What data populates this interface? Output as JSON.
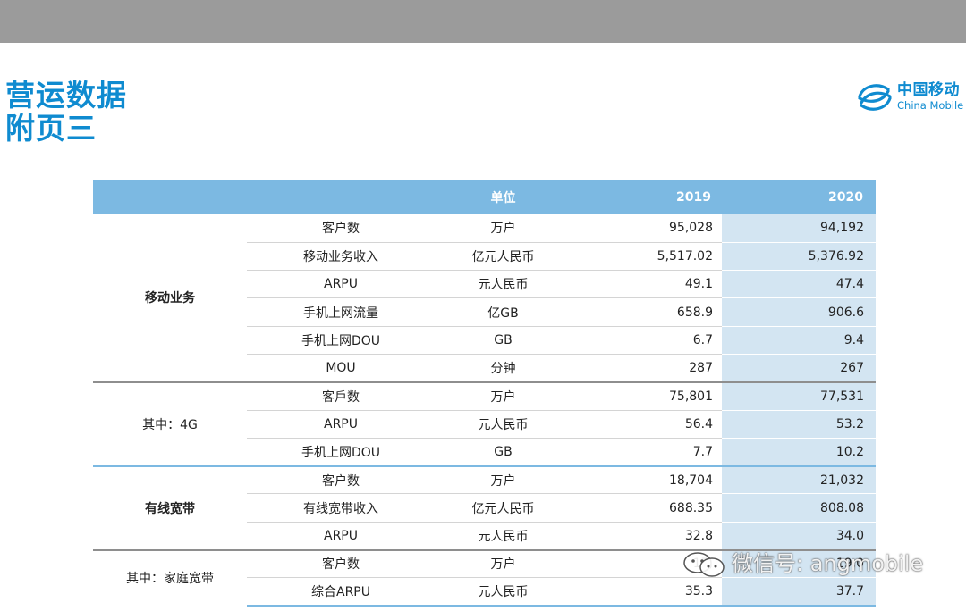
{
  "title_lines": [
    "营运数据",
    "附页三"
  ],
  "logo": {
    "cn": "中国移动",
    "en": "China Mobile",
    "color": "#0f8bd0"
  },
  "table": {
    "headers": {
      "group": "",
      "item": "",
      "unit": "单位",
      "y2019": "2019",
      "y2020": "2020"
    },
    "groups": [
      {
        "name": "移动业务",
        "bold": true,
        "rows": [
          {
            "item": "客户数",
            "unit": "万户",
            "v2019": "95,028",
            "v2020": "94,192"
          },
          {
            "item": "移动业务收入",
            "unit": "亿元人民币",
            "v2019": "5,517.02",
            "v2020": "5,376.92"
          },
          {
            "item": "ARPU",
            "unit": "元人民币",
            "v2019": "49.1",
            "v2020": "47.4"
          },
          {
            "item": "手机上网流量",
            "unit": "亿GB",
            "v2019": "658.9",
            "v2020": "906.6"
          },
          {
            "item": "手机上网DOU",
            "unit": "GB",
            "v2019": "6.7",
            "v2020": "9.4"
          },
          {
            "item": "MOU",
            "unit": "分钟",
            "v2019": "287",
            "v2020": "267"
          }
        ]
      },
      {
        "name": "其中：4G",
        "bold": false,
        "rows": [
          {
            "item": "客戶数",
            "unit": "万户",
            "v2019": "75,801",
            "v2020": "77,531"
          },
          {
            "item": "ARPU",
            "unit": "元人民币",
            "v2019": "56.4",
            "v2020": "53.2"
          },
          {
            "item": "手机上网DOU",
            "unit": "GB",
            "v2019": "7.7",
            "v2020": "10.2"
          }
        ]
      },
      {
        "name": "有线宽带",
        "bold": true,
        "rows": [
          {
            "item": "客户数",
            "unit": "万户",
            "v2019": "18,704",
            "v2020": "21,032"
          },
          {
            "item": "有线宽带收入",
            "unit": "亿元人民币",
            "v2019": "688.35",
            "v2020": "808.08"
          },
          {
            "item": "ARPU",
            "unit": "元人民币",
            "v2019": "32.8",
            "v2020": "34.0"
          }
        ]
      },
      {
        "name": "其中：家庭宽带",
        "bold": false,
        "rows": [
          {
            "item": "客户数",
            "unit": "万户",
            "v2019": "17,",
            "v2020": "19,0"
          },
          {
            "item": "综合ARPU",
            "unit": "元人民币",
            "v2019": "35.3",
            "v2020": "37.7"
          }
        ]
      }
    ]
  },
  "watermark": {
    "text": "微信号: angmobile"
  },
  "colors": {
    "header_bg": "#7cb9e2",
    "col2020_bg": "#d3e5f2",
    "title": "#0f8bd0",
    "topbar": "#9b9b9b"
  }
}
